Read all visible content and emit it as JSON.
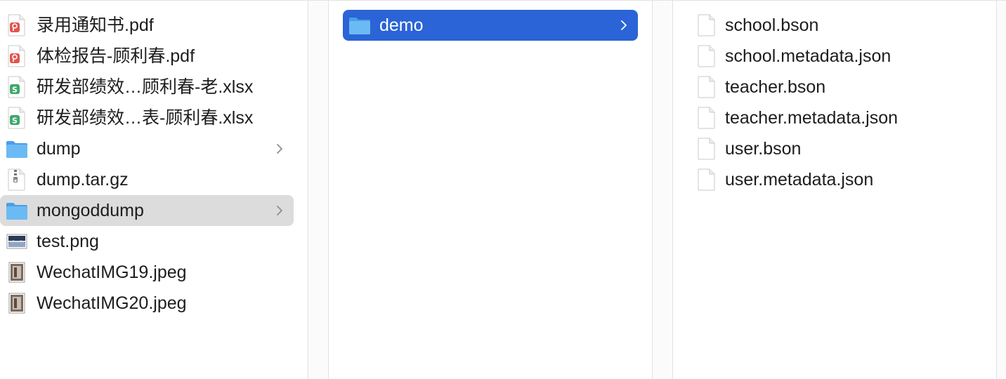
{
  "colors": {
    "selection_active": "#2a64d6",
    "selection_inactive": "#dcdcdc",
    "folder": "#5aaef0",
    "pdf_badge": "#e2554e",
    "xlsx_badge": "#3ea86a"
  },
  "column1": {
    "items": [
      {
        "label": "录用通知书.pdf",
        "icon": "pdf-file-icon"
      },
      {
        "label": "体检报告-顾利春.pdf",
        "icon": "pdf-file-icon"
      },
      {
        "label": "研发部绩效…顾利春-老.xlsx",
        "icon": "spreadsheet-file-icon"
      },
      {
        "label": "研发部绩效…表-顾利春.xlsx",
        "icon": "spreadsheet-file-icon"
      },
      {
        "label": "dump",
        "icon": "folder-icon"
      },
      {
        "label": "dump.tar.gz",
        "icon": "archive-file-icon"
      },
      {
        "label": "mongoddump",
        "icon": "folder-icon"
      },
      {
        "label": "test.png",
        "icon": "image-file-icon"
      },
      {
        "label": "WechatIMG19.jpeg",
        "icon": "photo-file-icon"
      },
      {
        "label": "WechatIMG20.jpeg",
        "icon": "photo-file-icon"
      }
    ]
  },
  "column2": {
    "items": [
      {
        "label": "demo",
        "icon": "folder-icon"
      }
    ]
  },
  "column3": {
    "items": [
      {
        "label": "school.bson",
        "icon": "document-file-icon"
      },
      {
        "label": "school.metadata.json",
        "icon": "document-file-icon"
      },
      {
        "label": "teacher.bson",
        "icon": "document-file-icon"
      },
      {
        "label": "teacher.metadata.json",
        "icon": "document-file-icon"
      },
      {
        "label": "user.bson",
        "icon": "document-file-icon"
      },
      {
        "label": "user.metadata.json",
        "icon": "document-file-icon"
      }
    ]
  }
}
